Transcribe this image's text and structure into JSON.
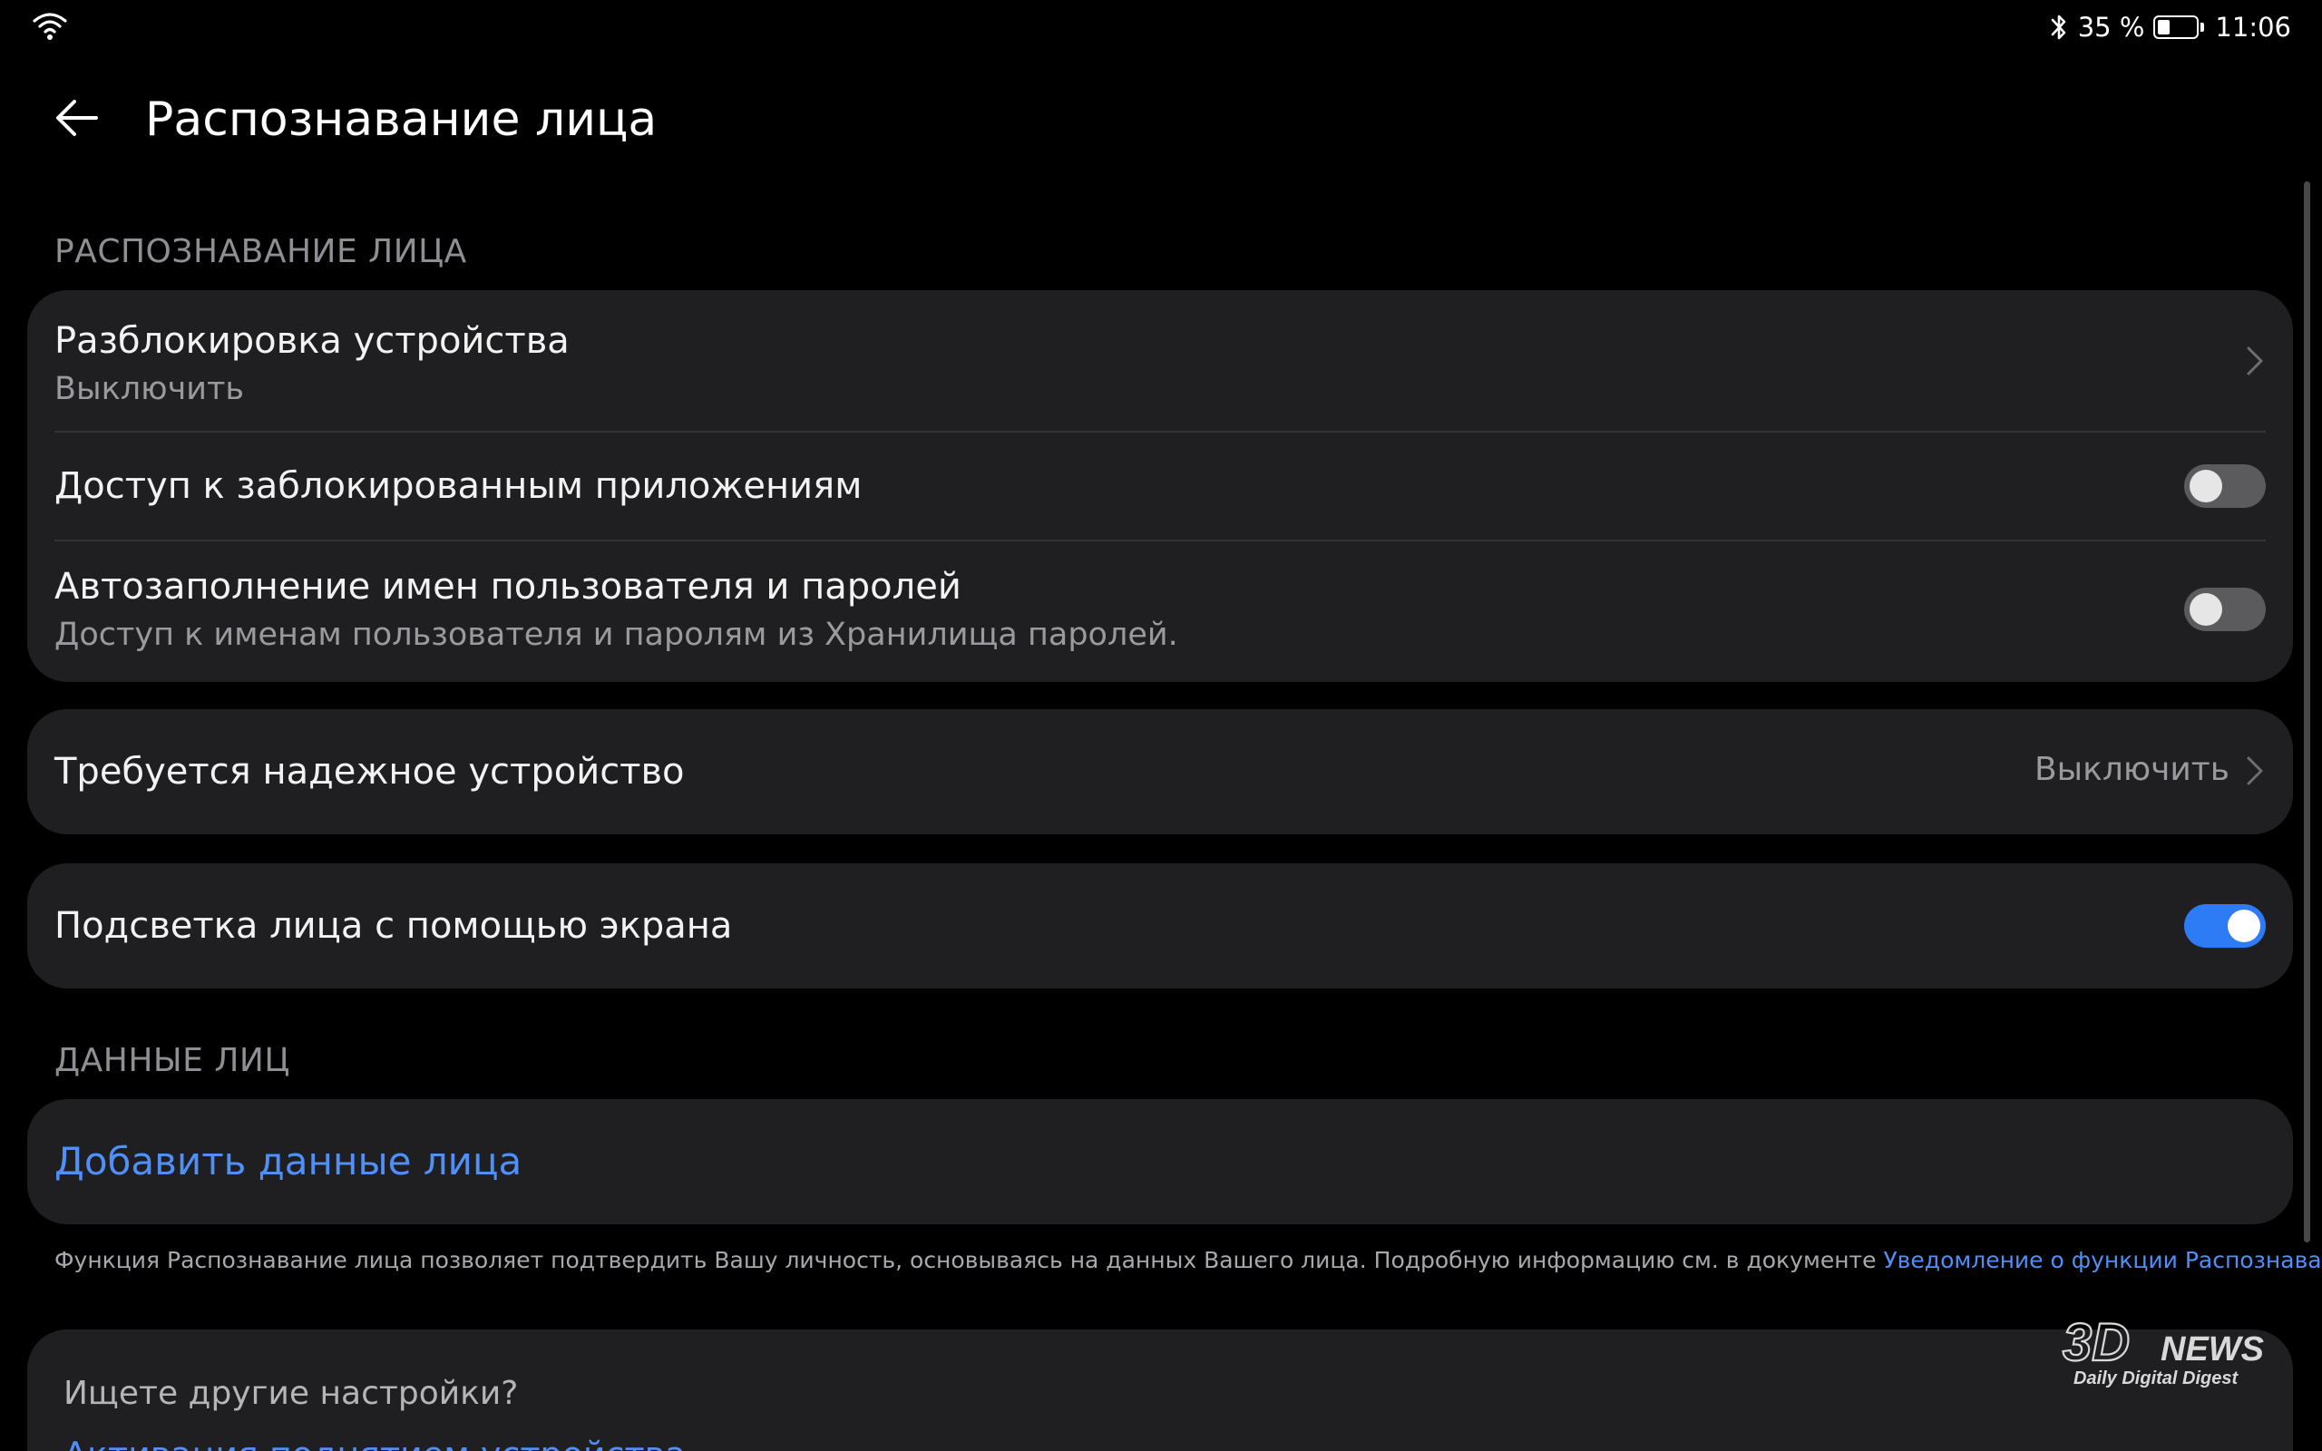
{
  "status_bar": {
    "battery_text": "35 %",
    "battery_level": 0.35,
    "time": "11:06",
    "icons": [
      "wifi-icon",
      "bluetooth-icon",
      "battery-icon"
    ]
  },
  "header": {
    "back_icon": "arrow-left-icon",
    "title": "Распознавание лица"
  },
  "section_face": {
    "label": "РАСПОЗНАВАНИЕ ЛИЦА",
    "items": [
      {
        "title": "Разблокировка устройства",
        "subtitle": "Выключить",
        "control": "chevron"
      },
      {
        "title": "Доступ к заблокированным приложениям",
        "control": "toggle",
        "checked": false
      },
      {
        "title": "Автозаполнение имен пользователя и паролей",
        "subtitle": "Доступ к именам пользователя и паролям из Хранилища паролей.",
        "control": "toggle",
        "checked": false
      }
    ]
  },
  "trusted_device": {
    "title": "Требуется надежное устройство",
    "value": "Выключить",
    "control": "chevron"
  },
  "screen_light": {
    "title": "Подсветка лица с помощью экрана",
    "control": "toggle",
    "checked": true
  },
  "section_data": {
    "label": "ДАННЫЕ ЛИЦ",
    "add_label": "Добавить данные лица"
  },
  "footnote": {
    "text": "Функция Распознавание лица позволяет подтвердить Вашу личность, основываясь на данных Вашего лица. Подробную информацию см. в документе ",
    "link": "Уведомление о функции Распознавание лица",
    "end": "."
  },
  "more": {
    "title": "Ищете другие настройки?",
    "link": "Активация поднятием устройства"
  },
  "watermark": {
    "brand": "3DNEWS",
    "tagline": "Daily Digital Digest"
  },
  "colors": {
    "background": "#000000",
    "card": "#1f1f21",
    "accent": "#4f8ff7",
    "toggle_on": "#2e7bf6",
    "toggle_off": "#5b5b5e"
  }
}
